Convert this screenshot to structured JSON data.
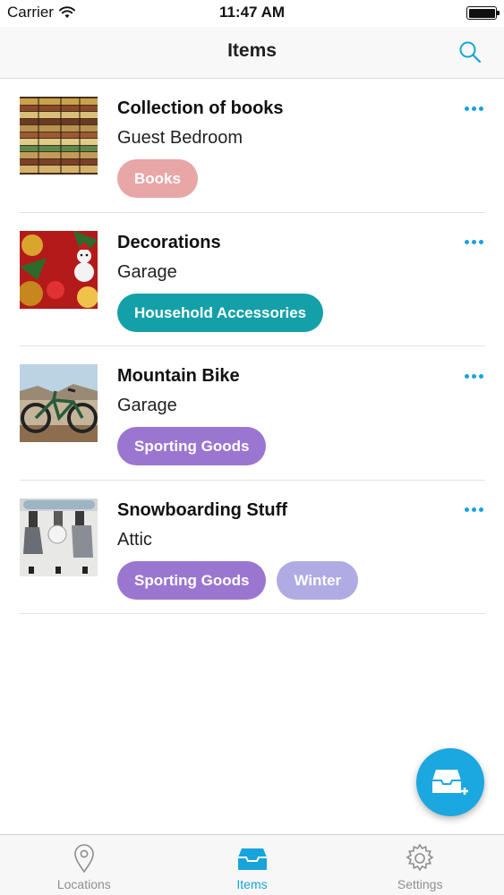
{
  "status_bar": {
    "carrier": "Carrier",
    "time": "11:47 AM"
  },
  "nav": {
    "title": "Items",
    "search_icon": "search-icon"
  },
  "colors": {
    "accent": "#17a3dc",
    "tag_books": "#e8a6a6",
    "tag_household": "#14a0a8",
    "tag_sporting": "#9b76d0",
    "tag_winter": "#b0abe3"
  },
  "items": [
    {
      "name": "Collection of books",
      "location": "Guest Bedroom",
      "image": "books-photo",
      "tags": [
        "Books"
      ]
    },
    {
      "name": "Decorations",
      "location": "Garage",
      "image": "decorations-photo",
      "tags": [
        "Household Accessories"
      ]
    },
    {
      "name": "Mountain Bike",
      "location": "Garage",
      "image": "bike-photo",
      "tags": [
        "Sporting Goods"
      ]
    },
    {
      "name": "Snowboarding Stuff",
      "location": "Attic",
      "image": "snowboard-photo",
      "tags": [
        "Sporting Goods",
        "Winter"
      ]
    }
  ],
  "fab": {
    "icon": "add-item-icon"
  },
  "tab_bar": {
    "tabs": [
      {
        "label": "Locations",
        "icon": "location-pin-icon",
        "active": false
      },
      {
        "label": "Items",
        "icon": "inbox-tray-icon",
        "active": true
      },
      {
        "label": "Settings",
        "icon": "gear-icon",
        "active": false
      }
    ]
  }
}
